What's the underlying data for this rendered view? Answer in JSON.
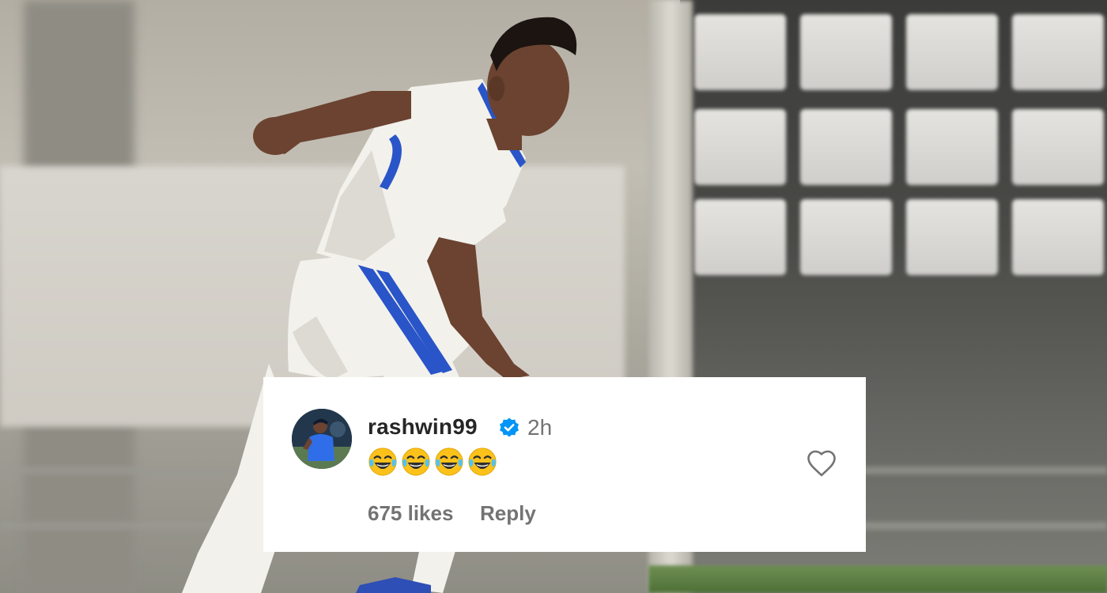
{
  "comment": {
    "username": "rashwin99",
    "verified": true,
    "timestamp": "2h",
    "text": "😂😂😂😂",
    "emoji_count": 4,
    "likes_label": "675 likes",
    "reply_label": "Reply"
  },
  "icons": {
    "verified": "verified-badge-icon",
    "like": "heart-outline-icon",
    "emoji": "face-with-tears-of-joy"
  },
  "colors": {
    "verified_blue": "#0095f6",
    "username": "#262626",
    "secondary_text": "#737373",
    "card_background": "#ffffff"
  }
}
